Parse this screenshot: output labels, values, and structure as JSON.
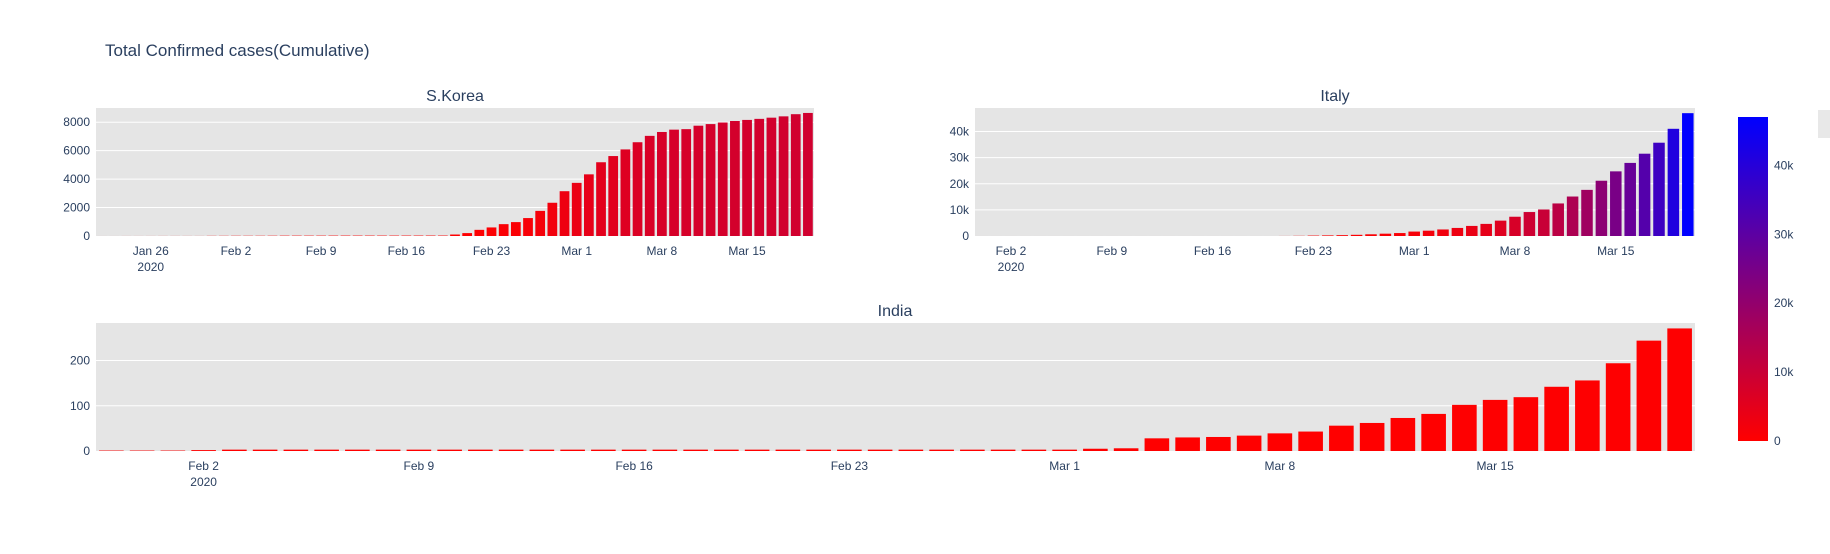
{
  "title": "Total Confirmed cases(Cumulative)",
  "colorscale": {
    "low": "#ff0000",
    "high": "#0000ff",
    "min": 0,
    "max": 47021,
    "ticks": [
      {
        "v": 0,
        "t": "0"
      },
      {
        "v": 10000,
        "t": "10k"
      },
      {
        "v": 20000,
        "t": "20k"
      },
      {
        "v": 30000,
        "t": "30k"
      },
      {
        "v": 40000,
        "t": "40k"
      }
    ]
  },
  "chart_data": [
    {
      "type": "bar",
      "title": "S.Korea",
      "x_start": "2020-01-22",
      "ylim": [
        0,
        9000
      ],
      "yticks": [
        {
          "v": 0,
          "t": "0"
        },
        {
          "v": 2000,
          "t": "2000"
        },
        {
          "v": 4000,
          "t": "4000"
        },
        {
          "v": 6000,
          "t": "6000"
        },
        {
          "v": 8000,
          "t": "8000"
        }
      ],
      "xticks": [
        {
          "date": "2020-01-26",
          "t": "Jan 26",
          "t2": "2020"
        },
        {
          "date": "2020-02-02",
          "t": "Feb 2"
        },
        {
          "date": "2020-02-09",
          "t": "Feb 9"
        },
        {
          "date": "2020-02-16",
          "t": "Feb 16"
        },
        {
          "date": "2020-02-23",
          "t": "Feb 23"
        },
        {
          "date": "2020-03-01",
          "t": "Mar 1"
        },
        {
          "date": "2020-03-08",
          "t": "Mar 8"
        },
        {
          "date": "2020-03-15",
          "t": "Mar 15"
        }
      ],
      "values": [
        1,
        1,
        2,
        2,
        3,
        4,
        4,
        4,
        4,
        11,
        12,
        15,
        15,
        16,
        19,
        23,
        24,
        24,
        25,
        27,
        28,
        28,
        28,
        28,
        28,
        29,
        30,
        31,
        31,
        104,
        204,
        433,
        602,
        833,
        977,
        1261,
        1766,
        2337,
        3150,
        3736,
        4335,
        5186,
        5621,
        6088,
        6593,
        7041,
        7314,
        7478,
        7513,
        7755,
        7869,
        7979,
        8086,
        8162,
        8236,
        8320,
        8413,
        8565,
        8652
      ]
    },
    {
      "type": "bar",
      "title": "Italy",
      "x_start": "2020-01-31",
      "ylim": [
        0,
        49000
      ],
      "yticks": [
        {
          "v": 0,
          "t": "0"
        },
        {
          "v": 10000,
          "t": "10k"
        },
        {
          "v": 20000,
          "t": "20k"
        },
        {
          "v": 30000,
          "t": "30k"
        },
        {
          "v": 40000,
          "t": "40k"
        }
      ],
      "xticks": [
        {
          "date": "2020-02-02",
          "t": "Feb 2",
          "t2": "2020"
        },
        {
          "date": "2020-02-09",
          "t": "Feb 9"
        },
        {
          "date": "2020-02-16",
          "t": "Feb 16"
        },
        {
          "date": "2020-02-23",
          "t": "Feb 23"
        },
        {
          "date": "2020-03-01",
          "t": "Mar 1"
        },
        {
          "date": "2020-03-08",
          "t": "Mar 8"
        },
        {
          "date": "2020-03-15",
          "t": "Mar 15"
        }
      ],
      "values": [
        2,
        2,
        2,
        2,
        2,
        2,
        2,
        3,
        3,
        3,
        3,
        3,
        3,
        3,
        3,
        3,
        3,
        3,
        3,
        3,
        3,
        20,
        62,
        155,
        229,
        322,
        453,
        655,
        888,
        1128,
        1694,
        2036,
        2502,
        3089,
        3858,
        4636,
        5883,
        7375,
        9172,
        10149,
        12462,
        15113,
        17660,
        21157,
        24747,
        27980,
        31506,
        35713,
        41035,
        47021
      ]
    },
    {
      "type": "bar",
      "title": "India",
      "x_start": "2020-01-30",
      "ylim": [
        0,
        283
      ],
      "yticks": [
        {
          "v": 0,
          "t": "0"
        },
        {
          "v": 100,
          "t": "100"
        },
        {
          "v": 200,
          "t": "200"
        }
      ],
      "xticks": [
        {
          "date": "2020-02-02",
          "t": "Feb 2",
          "t2": "2020"
        },
        {
          "date": "2020-02-09",
          "t": "Feb 9"
        },
        {
          "date": "2020-02-16",
          "t": "Feb 16"
        },
        {
          "date": "2020-02-23",
          "t": "Feb 23"
        },
        {
          "date": "2020-03-01",
          "t": "Mar 1"
        },
        {
          "date": "2020-03-08",
          "t": "Mar 8"
        },
        {
          "date": "2020-03-15",
          "t": "Mar 15"
        }
      ],
      "values": [
        1,
        1,
        1,
        2,
        3,
        3,
        3,
        3,
        3,
        3,
        3,
        3,
        3,
        3,
        3,
        3,
        3,
        3,
        3,
        3,
        3,
        3,
        3,
        3,
        3,
        3,
        3,
        3,
        3,
        3,
        3,
        3,
        5,
        6,
        28,
        30,
        31,
        34,
        39,
        43,
        56,
        62,
        73,
        82,
        102,
        113,
        119,
        142,
        156,
        194,
        244,
        271
      ]
    }
  ]
}
